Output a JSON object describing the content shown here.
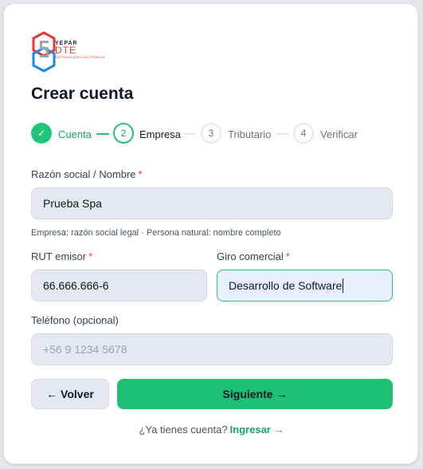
{
  "logo": {
    "brand_top": "YEPAR",
    "brand_main": "DTE",
    "brand_sub": "FACTURACIÓN ELECTRÓNICA"
  },
  "page_title": "Crear cuenta",
  "stepper": {
    "steps": [
      {
        "marker": "✓",
        "label": "Cuenta",
        "state": "done"
      },
      {
        "marker": "2",
        "label": "Empresa",
        "state": "active"
      },
      {
        "marker": "3",
        "label": "Tributario",
        "state": "todo"
      },
      {
        "marker": "4",
        "label": "Verificar",
        "state": "todo"
      }
    ]
  },
  "form": {
    "razon_social": {
      "label": "Razón social / Nombre",
      "required_mark": "*",
      "value": "Prueba Spa",
      "hint": "Empresa: razón social legal · Persona natural: nombre completo"
    },
    "rut": {
      "label": "RUT emisor",
      "required_mark": "*",
      "value": "66.666.666-6"
    },
    "giro": {
      "label": "Giro comercial",
      "required_mark": "*",
      "value": "Desarrollo de Software"
    },
    "telefono": {
      "label": "Teléfono (opcional)",
      "placeholder": "+56 9 1234 5678",
      "value": ""
    }
  },
  "buttons": {
    "back": "← Volver",
    "next": "Siguiente →"
  },
  "footer": {
    "prompt": "¿Ya tienes cuenta?",
    "link": "Ingresar →"
  },
  "colors": {
    "accent": "#22c577",
    "required": "#e53935",
    "input_bg": "#e5e8f1"
  }
}
